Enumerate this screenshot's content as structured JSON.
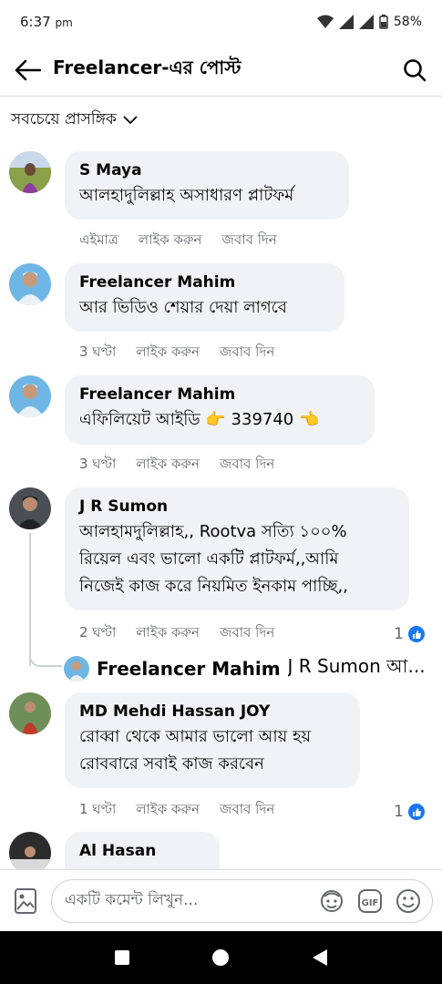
{
  "status": {
    "time": "6:37",
    "ampm": "pm",
    "battery": "58%"
  },
  "header": {
    "title": "Freelancer-এর পোস্ট"
  },
  "sort": {
    "label": "সবচেয়ে প্রাসঙ্গিক"
  },
  "comments": [
    {
      "name": "S Maya",
      "text": "আলহাদুলিল্লাহ অসাধারণ প্লাটফর্ম",
      "time": "এইমাত্র",
      "like": "লাইক করুন",
      "reply": "জবাব দিন"
    },
    {
      "name": "Freelancer Mahim",
      "text": "আর ভিডিও শেয়ার দেয়া লাগবে",
      "time": "3 ঘণ্টা",
      "like": "লাইক করুন",
      "reply": "জবাব দিন"
    },
    {
      "name": "Freelancer Mahim",
      "text": "এফিলিয়েট আইডি 👉 339740 👈",
      "time": "3 ঘণ্টা",
      "like": "লাইক করুন",
      "reply": "জবাব দিন"
    },
    {
      "name": "J R Sumon",
      "text_lines": [
        "আলহামদুলিল্লাহ,, Rootva সত্যি ১০০%",
        "রিয়েল এবং ভালো একটি প্লাটফর্ম,,আমি",
        "নিজেই কাজ করে নিয়মিত ইনকাম পাচ্ছি,,"
      ],
      "time": "2 ঘণ্টা",
      "like": "লাইক করুন",
      "reply": "জবাব দিন",
      "reactions": "1"
    },
    {
      "name": "MD Mehdi Hassan JOY",
      "text_lines": [
        "রোব্বা থেকে আমার ভালো আয় হয়",
        "রোববারে সবাই কাজ করবেন"
      ],
      "time": "1 ঘণ্টা",
      "like": "লাইক করুন",
      "reply": "জবাব দিন",
      "reactions": "1"
    },
    {
      "name": "Al Hasan"
    }
  ],
  "reply_preview": {
    "name": "Freelancer Mahim",
    "text": "J R Sumon আ..."
  },
  "composer": {
    "placeholder": "একটি কমেন্ট লিখুন..."
  },
  "colors": {
    "accent": "#1877f2",
    "bubble": "#f0f2f5",
    "muted": "#65676b"
  }
}
